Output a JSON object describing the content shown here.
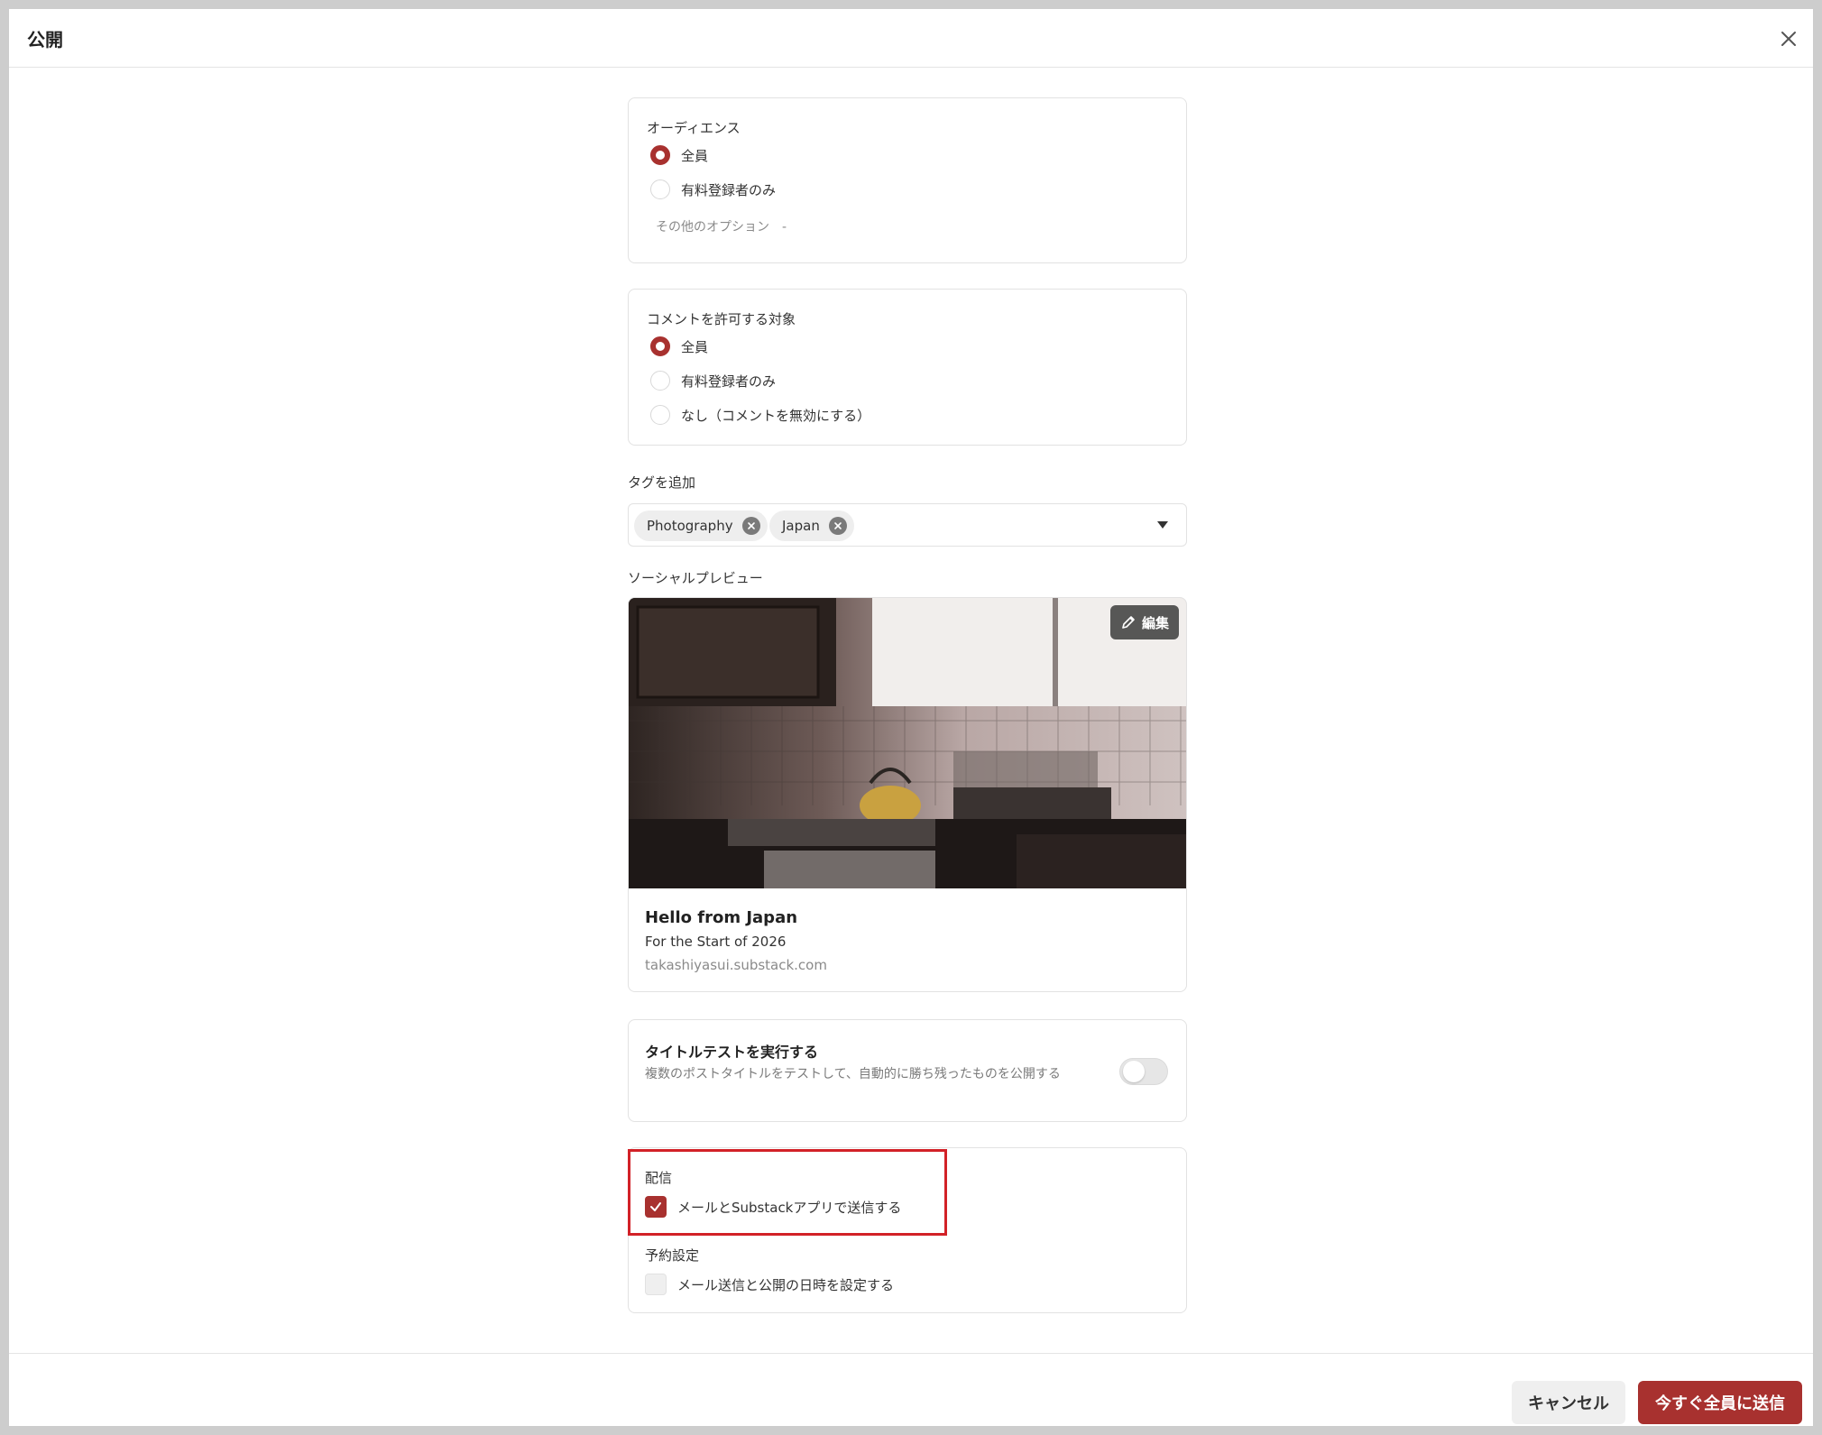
{
  "dialog": {
    "title": "公開"
  },
  "audience": {
    "label": "オーディエンス",
    "options": [
      "全員",
      "有料登録者のみ"
    ],
    "selected": "全員",
    "more_options": "その他のオプション　-"
  },
  "comments": {
    "label": "コメントを許可する対象",
    "options": [
      "全員",
      "有料登録者のみ",
      "なし（コメントを無効にする）"
    ],
    "selected": "全員"
  },
  "tags": {
    "label": "タグを追加",
    "items": [
      "Photography",
      "Japan"
    ]
  },
  "social_preview": {
    "label": "ソーシャルプレビュー",
    "edit_label": "編集",
    "title": "Hello from Japan",
    "subtitle": "For the Start of 2026",
    "url": "takashiyasui.substack.com"
  },
  "title_test": {
    "title": "タイトルテストを実行する",
    "description": "複数のポストタイトルをテストして、自動的に勝ち残ったものを公開する",
    "enabled": false
  },
  "delivery": {
    "label": "配信",
    "option": "メールとSubstackアプリで送信する",
    "checked": true,
    "schedule_label": "予約設定",
    "schedule_option": "メール送信と公開の日時を設定する",
    "schedule_checked": false
  },
  "footer": {
    "cancel_label": "キャンセル",
    "send_label": "今すぐ全員に送信"
  },
  "colors": {
    "accent": "#a8312f",
    "highlight": "#d22127"
  }
}
